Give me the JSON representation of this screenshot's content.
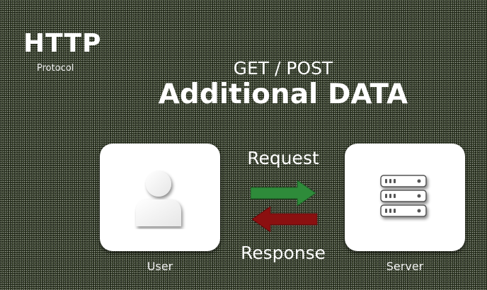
{
  "brand": {
    "title": "HTTP",
    "subtitle": "Protocol"
  },
  "headline": {
    "method": "GET / POST",
    "title": "Additional DATA"
  },
  "flow": {
    "request_label": "Request",
    "response_label": "Response",
    "request_color": "#2e8b3a",
    "response_color": "#8b1010"
  },
  "nodes": {
    "user": {
      "label": "User",
      "icon": "user-icon"
    },
    "server": {
      "label": "Server",
      "icon": "server-icon"
    }
  }
}
